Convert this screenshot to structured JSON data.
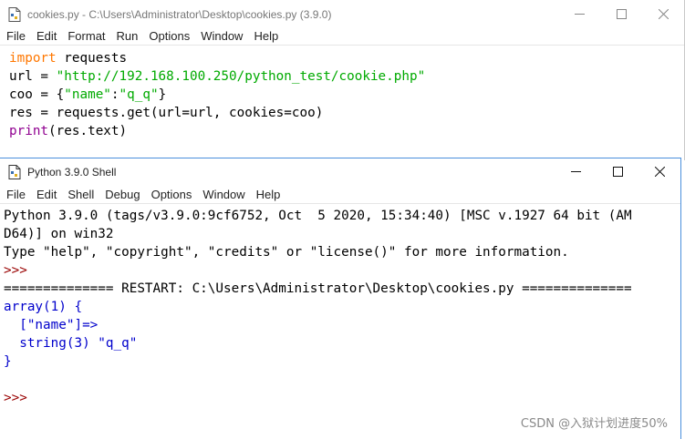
{
  "editor": {
    "title": "cookies.py - C:\\Users\\Administrator\\Desktop\\cookies.py (3.9.0)",
    "menu": [
      "File",
      "Edit",
      "Format",
      "Run",
      "Options",
      "Window",
      "Help"
    ],
    "code": {
      "l1_kw": "import",
      "l1_rest": " requests",
      "l2_a": "url = ",
      "l2_str": "\"http://192.168.100.250/python_test/cookie.php\"",
      "l3_a": "coo = {",
      "l3_s1": "\"name\"",
      "l3_b": ":",
      "l3_s2": "\"q_q\"",
      "l3_c": "}",
      "l4": "res = requests.get(url=url, cookies=coo)",
      "l5_bi": "print",
      "l5_rest": "(res.text)"
    }
  },
  "shell": {
    "title": "Python 3.9.0 Shell",
    "menu": [
      "File",
      "Edit",
      "Shell",
      "Debug",
      "Options",
      "Window",
      "Help"
    ],
    "lines": {
      "banner1": "Python 3.9.0 (tags/v3.9.0:9cf6752, Oct  5 2020, 15:34:40) [MSC v.1927 64 bit (AM",
      "banner2": "D64)] on win32",
      "banner3": "Type \"help\", \"copyright\", \"credits\" or \"license()\" for more information.",
      "prompt": ">>> ",
      "restart": "============== RESTART: C:\\Users\\Administrator\\Desktop\\cookies.py ==============",
      "out1": "array(1) {",
      "out2": "  [\"name\"]=>",
      "out3": "  string(3) \"q_q\"",
      "out4": "}",
      "prompt2": ">>> "
    }
  },
  "watermark": "CSDN @入狱计划进度50%"
}
